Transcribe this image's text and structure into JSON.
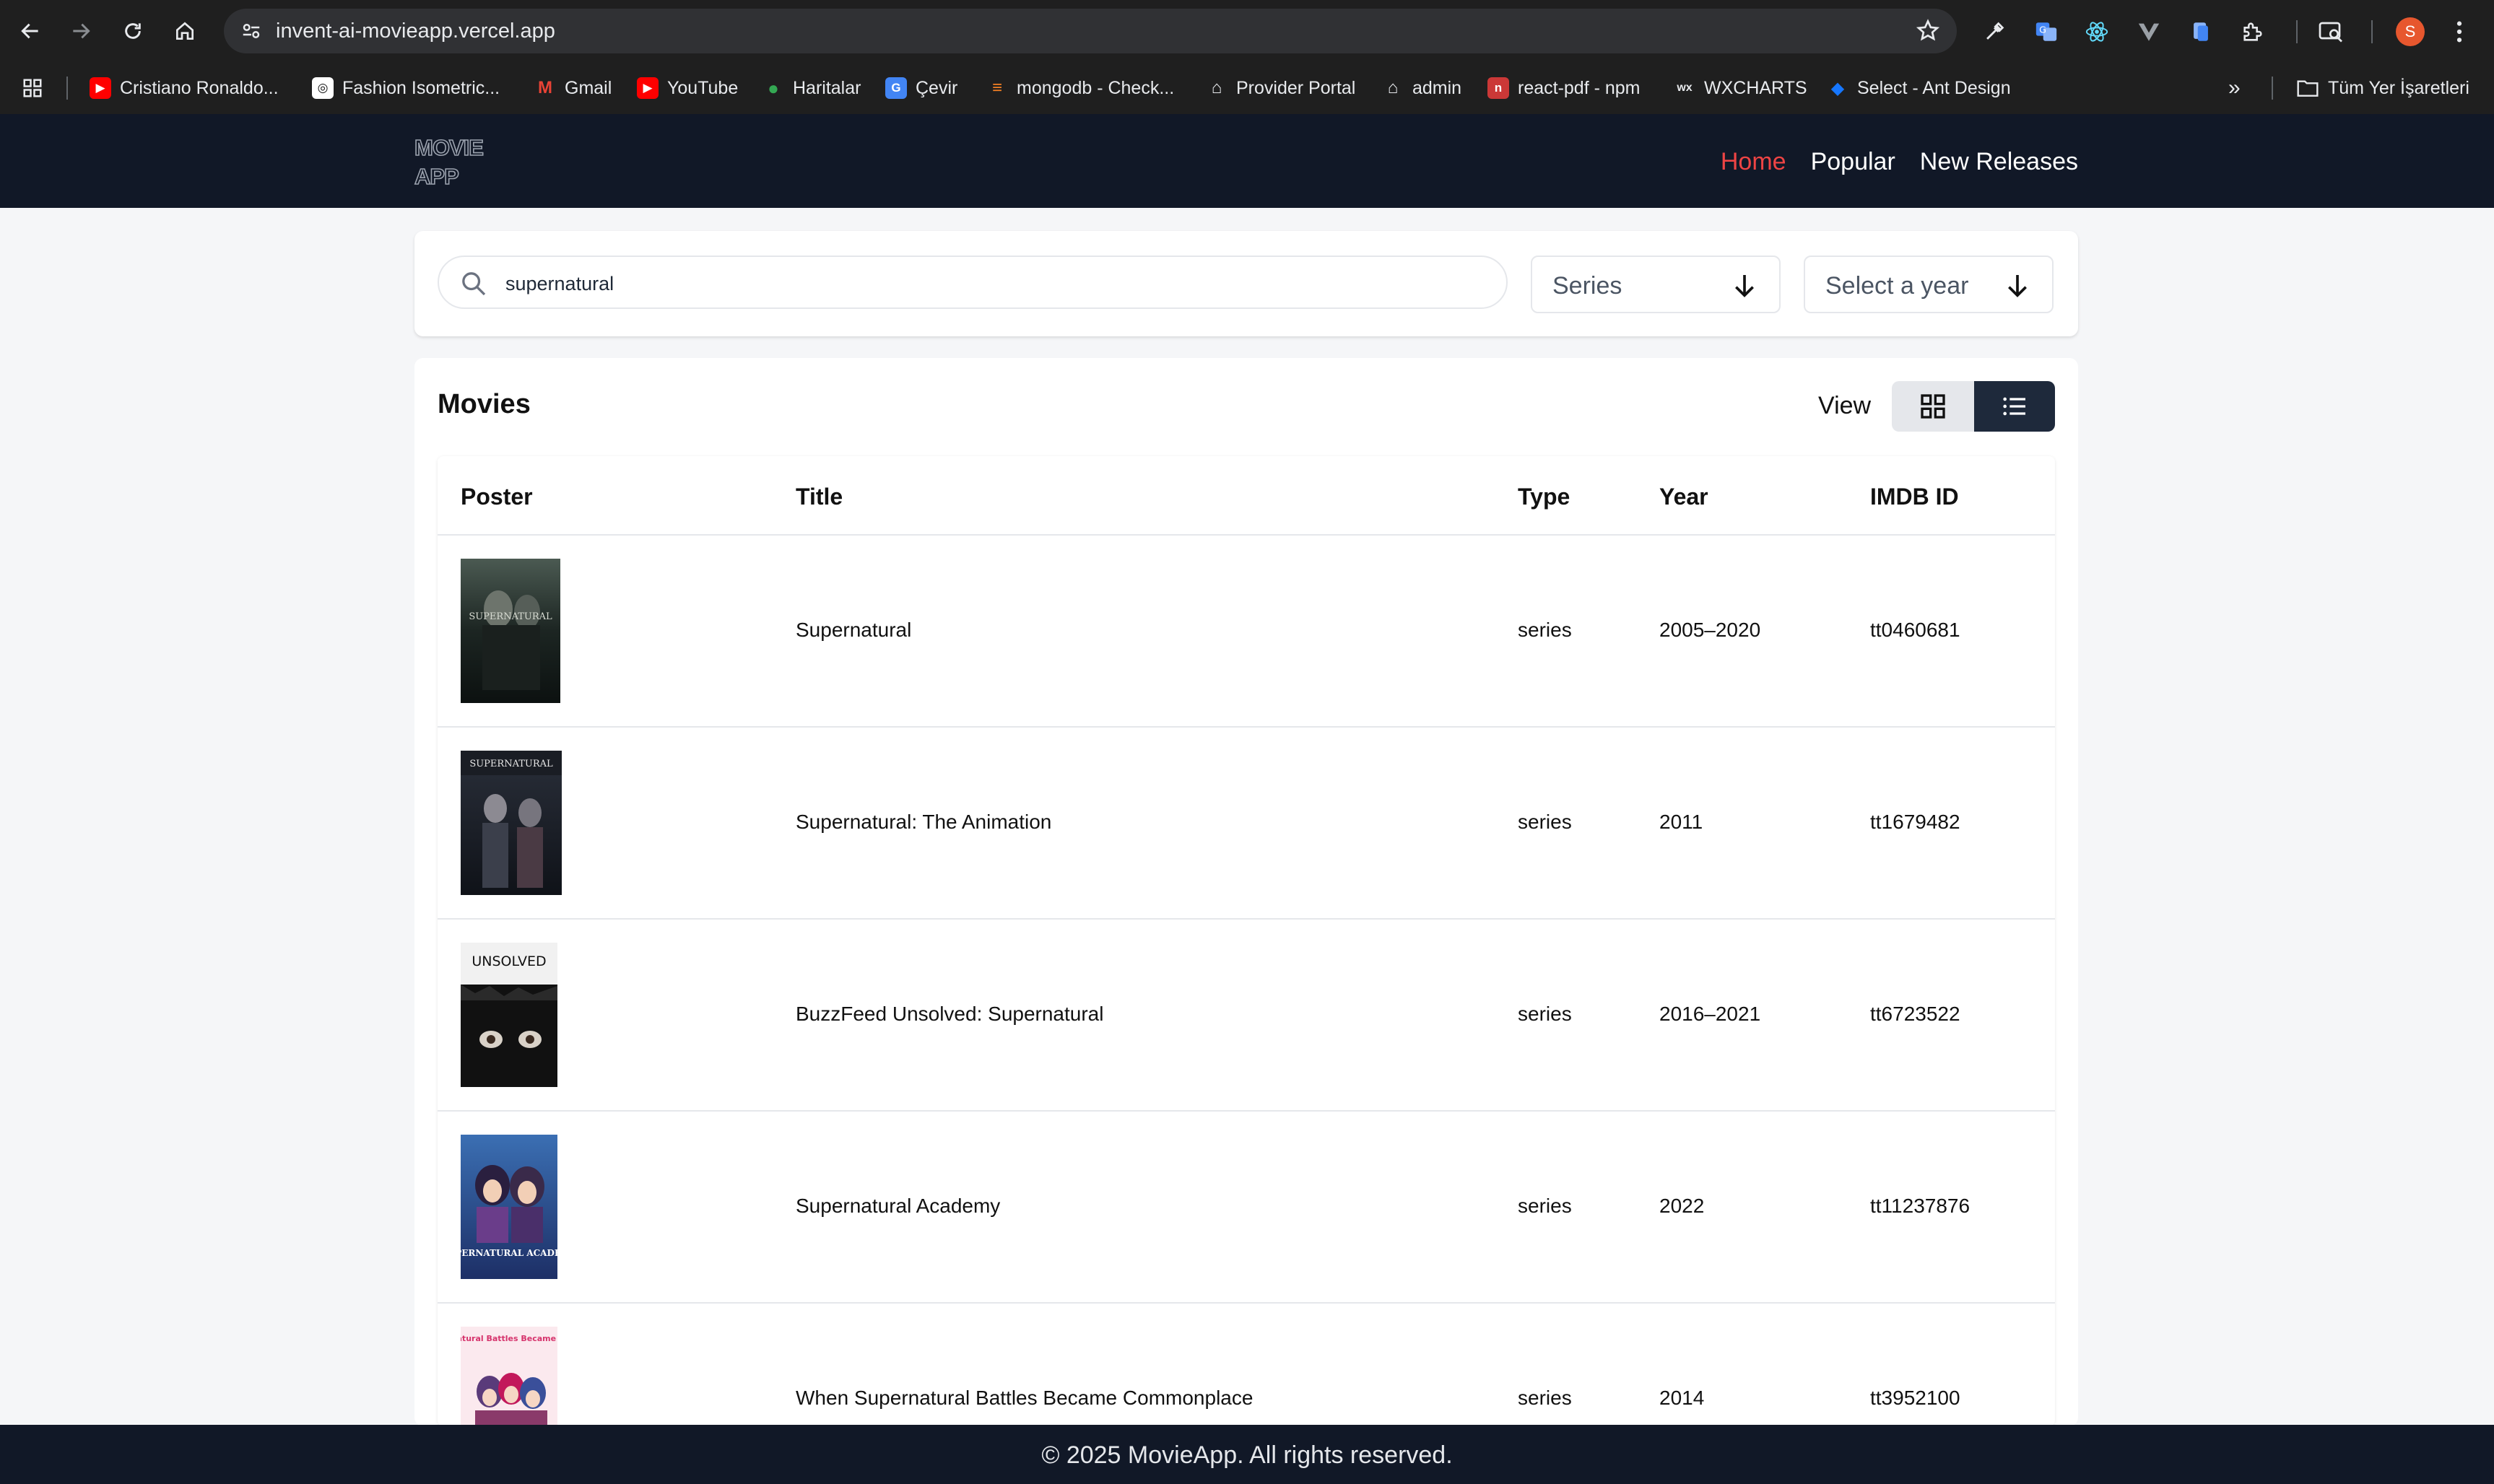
{
  "browser": {
    "url": "invent-ai-movieapp.vercel.app",
    "profile_initial": "S",
    "bookmarks": [
      {
        "label": "Cristiano Ronaldo...",
        "icon": "youtube-icon"
      },
      {
        "label": "Fashion Isometric...",
        "icon": "globe-icon"
      },
      {
        "label": "Gmail",
        "icon": "gmail-icon"
      },
      {
        "label": "YouTube",
        "icon": "youtube-icon"
      },
      {
        "label": "Haritalar",
        "icon": "maps-icon"
      },
      {
        "label": "Çevir",
        "icon": "translate-icon"
      },
      {
        "label": "mongodb - Check...",
        "icon": "stackoverflow-icon"
      },
      {
        "label": "Provider Portal",
        "icon": "home-icon"
      },
      {
        "label": "admin",
        "icon": "home-icon"
      },
      {
        "label": "react-pdf - npm",
        "icon": "npm-icon"
      },
      {
        "label": "WXCHARTS",
        "icon": "wx-icon"
      },
      {
        "label": "Select - Ant Design",
        "icon": "antd-icon"
      }
    ],
    "more_bookmarks": "»",
    "all_bookmarks": "Tüm Yer İşaretleri"
  },
  "header": {
    "logo_line1": "MOVIE",
    "logo_line2": "APP",
    "nav": [
      {
        "label": "Home",
        "active": true
      },
      {
        "label": "Popular",
        "active": false
      },
      {
        "label": "New Releases",
        "active": false
      }
    ]
  },
  "filters": {
    "search_value": "supernatural",
    "type_select": "Series",
    "year_placeholder": "Select a year"
  },
  "movies": {
    "title": "Movies",
    "view_label": "View",
    "view_mode": "list",
    "columns": [
      "Poster",
      "Title",
      "Type",
      "Year",
      "IMDB ID"
    ],
    "rows": [
      {
        "title": "Supernatural",
        "type": "series",
        "year": "2005–2020",
        "imdb": "tt0460681",
        "poster_text": "SUPERNATURAL"
      },
      {
        "title": "Supernatural: The Animation",
        "type": "series",
        "year": "2011",
        "imdb": "tt1679482",
        "poster_text": "SUPERNATURAL"
      },
      {
        "title": "BuzzFeed Unsolved: Supernatural",
        "type": "series",
        "year": "2016–2021",
        "imdb": "tt6723522",
        "poster_text": "UNSOLVED"
      },
      {
        "title": "Supernatural Academy",
        "type": "series",
        "year": "2022",
        "imdb": "tt11237876",
        "poster_text": "SUPERNATURAL ACADEMY"
      },
      {
        "title": "When Supernatural Battles Became Commonplace",
        "type": "series",
        "year": "2014",
        "imdb": "tt3952100",
        "poster_text": "When Supernatural Battles Became Commonplace"
      }
    ]
  },
  "footer": {
    "text": "© 2025 MovieApp. All rights reserved."
  }
}
